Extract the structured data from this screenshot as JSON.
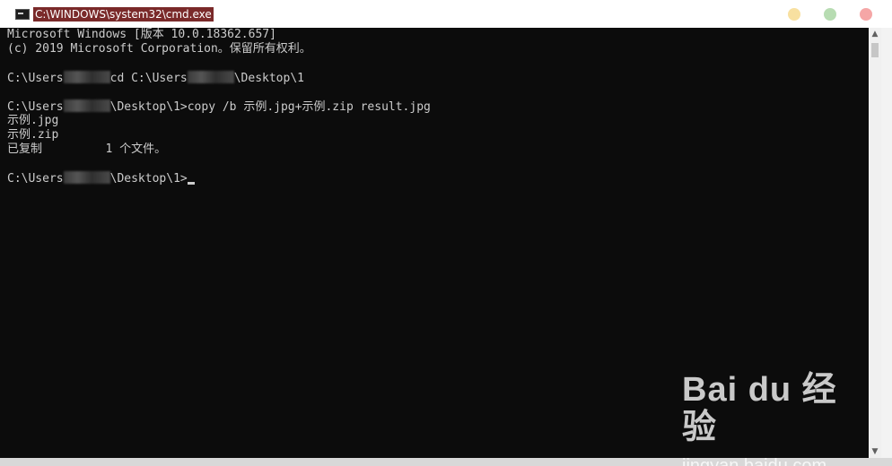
{
  "window": {
    "title": "C:\\WINDOWS\\system32\\cmd.exe",
    "icon": "cmd-app-icon"
  },
  "terminal": {
    "line1": "Microsoft Windows [版本 10.0.18362.657]",
    "line2": "(c) 2019 Microsoft Corporation。保留所有权利。",
    "prompt_prefix": "C:\\Users",
    "cd_command": "cd C:\\Users",
    "cd_suffix": "\\Desktop\\1",
    "prompt_desktop": "\\Desktop\\1>",
    "copy_command": "copy /b 示例.jpg+示例.zip result.jpg",
    "out_file1": "示例.jpg",
    "out_file2": "示例.zip",
    "out_copied": "已复制         1 个文件。"
  },
  "watermark": {
    "logo": "Bai du 经验",
    "url": "jingyan.baidu.com"
  }
}
